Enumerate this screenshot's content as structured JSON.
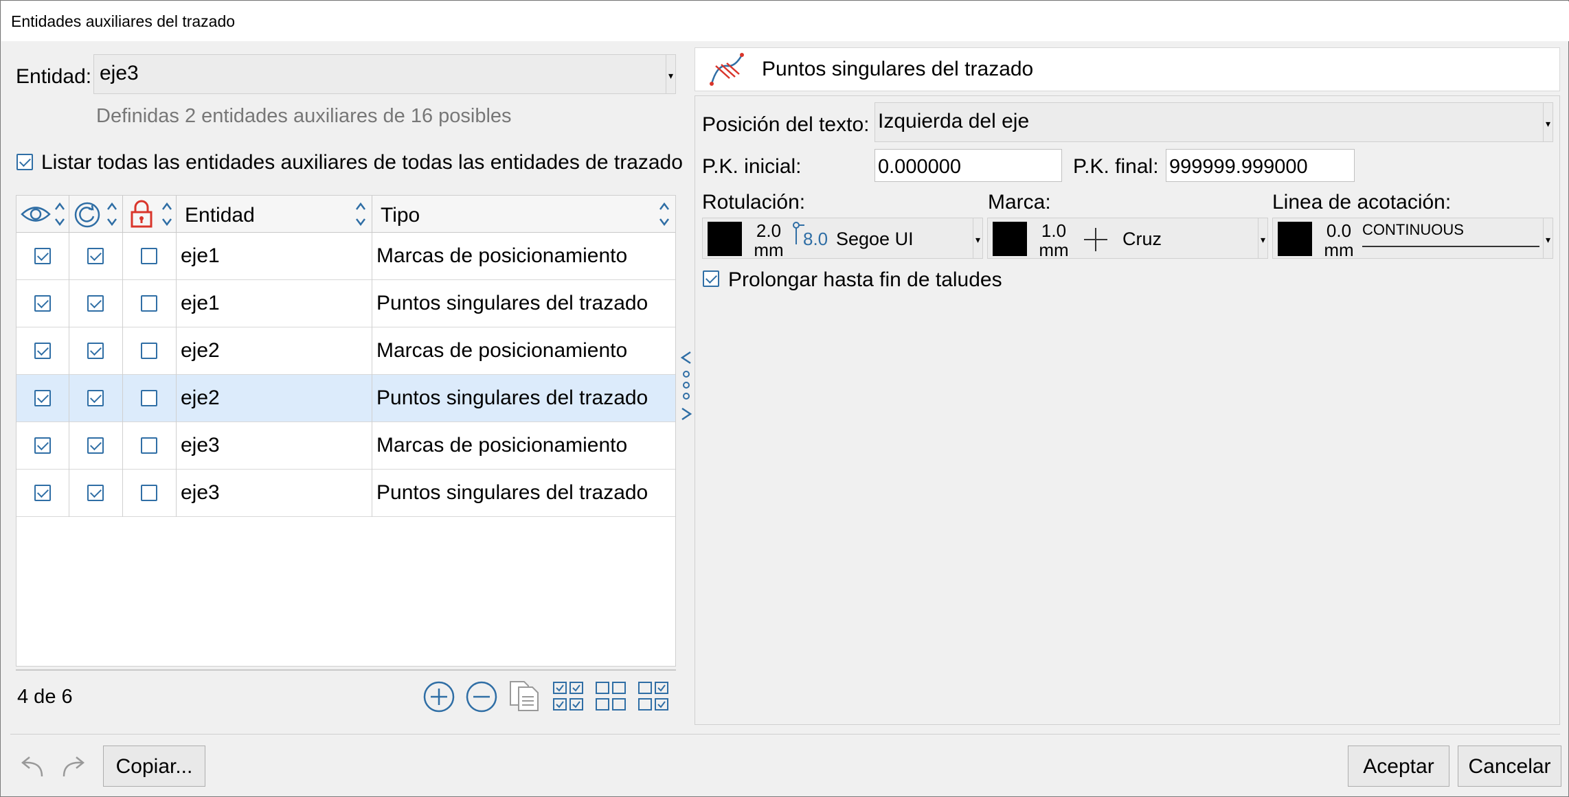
{
  "window": {
    "title": "Entidades auxiliares del trazado"
  },
  "entity": {
    "label": "Entidad:",
    "value": "eje3",
    "info": "Definidas 2 entidades auxiliares de 16 posibles"
  },
  "list_all": {
    "label": "Listar todas las entidades auxiliares de todas las entidades de trazado",
    "checked": true
  },
  "table": {
    "columns": [
      "Entidad",
      "Tipo"
    ],
    "rows": [
      {
        "visible": true,
        "refresh": true,
        "locked": false,
        "entidad": "eje1",
        "tipo": "Marcas de posicionamiento"
      },
      {
        "visible": true,
        "refresh": true,
        "locked": false,
        "entidad": "eje1",
        "tipo": "Puntos singulares del trazado"
      },
      {
        "visible": true,
        "refresh": true,
        "locked": false,
        "entidad": "eje2",
        "tipo": "Marcas de posicionamiento"
      },
      {
        "visible": true,
        "refresh": true,
        "locked": false,
        "entidad": "eje2",
        "tipo": "Puntos singulares del trazado",
        "selected": true
      },
      {
        "visible": true,
        "refresh": true,
        "locked": false,
        "entidad": "eje3",
        "tipo": "Marcas de posicionamiento"
      },
      {
        "visible": true,
        "refresh": true,
        "locked": false,
        "entidad": "eje3",
        "tipo": "Puntos singulares del trazado"
      }
    ]
  },
  "footer": {
    "count": "4 de 6"
  },
  "panel": {
    "title": "Puntos singulares del trazado",
    "pos_text_label": "Posición del texto:",
    "pos_text_value": "Izquierda del eje",
    "pk_ini_label": "P.K. inicial:",
    "pk_ini_value": "0.000000",
    "pk_fin_label": "P.K. final:",
    "pk_fin_value": "999999.999000",
    "rotulacion_label": "Rotulación:",
    "rot_size": "2.0",
    "rot_unit": "mm",
    "rot_height": "8.0",
    "rot_font": "Segoe UI",
    "marca_label": "Marca:",
    "marca_size": "1.0",
    "marca_unit": "mm",
    "marca_name": "Cruz",
    "linea_label": "Linea de acotación:",
    "linea_size": "0.0",
    "linea_unit": "mm",
    "linea_type": "CONTINUOUS",
    "prolongar_label": "Prolongar hasta fin de taludes",
    "prolongar_checked": true
  },
  "buttons": {
    "copiar": "Copiar...",
    "aceptar": "Aceptar",
    "cancelar": "Cancelar"
  },
  "colors": {
    "accent": "#2f6ea5",
    "lock": "#d9352b",
    "selection": "#dcebfb"
  }
}
